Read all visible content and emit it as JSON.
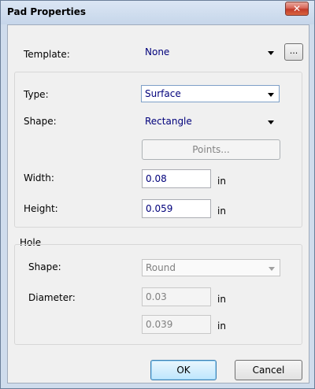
{
  "window": {
    "title": "Pad Properties",
    "close_glyph": "✕"
  },
  "template": {
    "label": "Template:",
    "value": "None",
    "browse_label": "..."
  },
  "pad": {
    "type_label": "Type:",
    "type_value": "Surface",
    "shape_label": "Shape:",
    "shape_value": "Rectangle",
    "points_label": "Points...",
    "width_label": "Width:",
    "width_value": "0.08",
    "width_unit": "in",
    "height_label": "Height:",
    "height_value": "0.059",
    "height_unit": "in"
  },
  "hole": {
    "group_label": "Hole",
    "shape_label": "Shape:",
    "shape_value": "Round",
    "diameter_label": "Diameter:",
    "diameter_value": "0.03",
    "diameter_unit": "in",
    "extra_value": "0.039",
    "extra_unit": "in"
  },
  "buttons": {
    "ok": "OK",
    "cancel": "Cancel"
  },
  "icons": {
    "close": "close-icon",
    "dropdown": "chevron-down-icon"
  }
}
